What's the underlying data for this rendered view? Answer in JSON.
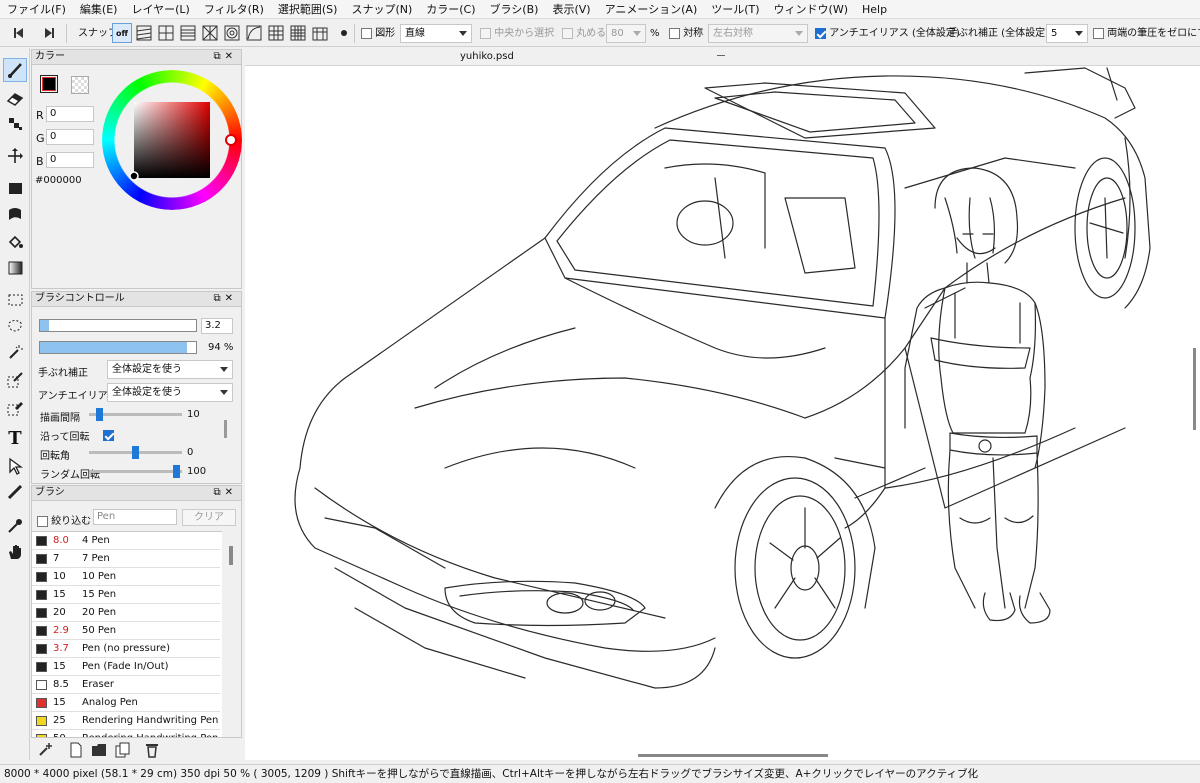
{
  "menu": [
    "ファイル(F)",
    "編集(E)",
    "レイヤー(L)",
    "フィルタ(R)",
    "選択範囲(S)",
    "スナップ(N)",
    "カラー(C)",
    "ブラシ(B)",
    "表示(V)",
    "アニメーション(A)",
    "ツール(T)",
    "ウィンドウ(W)",
    "Help"
  ],
  "toolbar": {
    "snap_label": "スナップ",
    "snap_off": "off",
    "shape_label": "図形",
    "shape_value": "直線",
    "center_label": "中央から選択",
    "round_label": "丸める",
    "round_value": "80",
    "percent": "%",
    "symmetry_label": "対称",
    "symmetry_value": "左右対称",
    "antialias_label": "アンチエイリアス (全体設定)",
    "stabilizer_label": "手ぶれ補正 (全体設定)",
    "stabilizer_value": "5",
    "taper_label": "両端の筆圧をゼロにする"
  },
  "color_panel": {
    "title": "カラー",
    "r_label": "R",
    "r_value": "0",
    "g_label": "G",
    "g_value": "0",
    "b_label": "B",
    "b_value": "0",
    "hex": "#000000",
    "fg": "#000000",
    "bg": "#ffffff"
  },
  "brush_control": {
    "title": "ブラシコントロール",
    "size_value": "3.2",
    "size_fraction": 0.06,
    "opacity_value": "94 %",
    "opacity_fraction": 0.94,
    "stabilizer_label": "手ぶれ補正",
    "stabilizer_value": "全体設定を使う",
    "antialias_label": "アンチエイリアス",
    "antialias_value": "全体設定を使う",
    "interval_label": "描画間隔",
    "interval_value": "10",
    "rotate_follow_label": "沿って回転",
    "rotation_label": "回転角",
    "rotation_value": "0",
    "random_label": "ランダム回転",
    "random_value": "100"
  },
  "brush_panel": {
    "title": "ブラシ",
    "filter_label": "絞り込む",
    "filter_placeholder": "Pen",
    "clear_label": "クリア",
    "items": [
      {
        "size": "8.0",
        "name": "4 Pen",
        "color": "#222222",
        "size_color": "#d02020"
      },
      {
        "size": "7",
        "name": "7 Pen",
        "color": "#222222",
        "size_color": "#111111"
      },
      {
        "size": "10",
        "name": "10 Pen",
        "color": "#222222",
        "size_color": "#111111"
      },
      {
        "size": "15",
        "name": "15 Pen",
        "color": "#222222",
        "size_color": "#111111"
      },
      {
        "size": "20",
        "name": "20 Pen",
        "color": "#222222",
        "size_color": "#111111"
      },
      {
        "size": "2.9",
        "name": "50 Pen",
        "color": "#222222",
        "size_color": "#d02020"
      },
      {
        "size": "3.7",
        "name": "Pen (no pressure)",
        "color": "#222222",
        "size_color": "#d02020"
      },
      {
        "size": "15",
        "name": "Pen (Fade In/Out)",
        "color": "#222222",
        "size_color": "#111111"
      },
      {
        "size": "8.5",
        "name": "Eraser",
        "color": "#ffffff",
        "size_color": "#111111"
      },
      {
        "size": "15",
        "name": "Analog Pen",
        "color": "#e03030",
        "size_color": "#111111"
      },
      {
        "size": "25",
        "name": "Rendering Handwriting Pen (Li",
        "color": "#f0d820",
        "size_color": "#111111"
      },
      {
        "size": "50",
        "name": "Rendering Handwriting Pen (Ri",
        "color": "#f0d820",
        "size_color": "#111111"
      }
    ]
  },
  "document": {
    "tab_title": "yuhiko.psd"
  },
  "status": "8000 * 4000 pixel   (58.1 * 29 cm)   350 dpi   50 %   ( 3005, 1209 )   Shiftキーを押しながらで直線描画、Ctrl+Altキーを押しながら左右ドラッグでブラシサイズ変更、A+クリックでレイヤーのアクティブ化"
}
